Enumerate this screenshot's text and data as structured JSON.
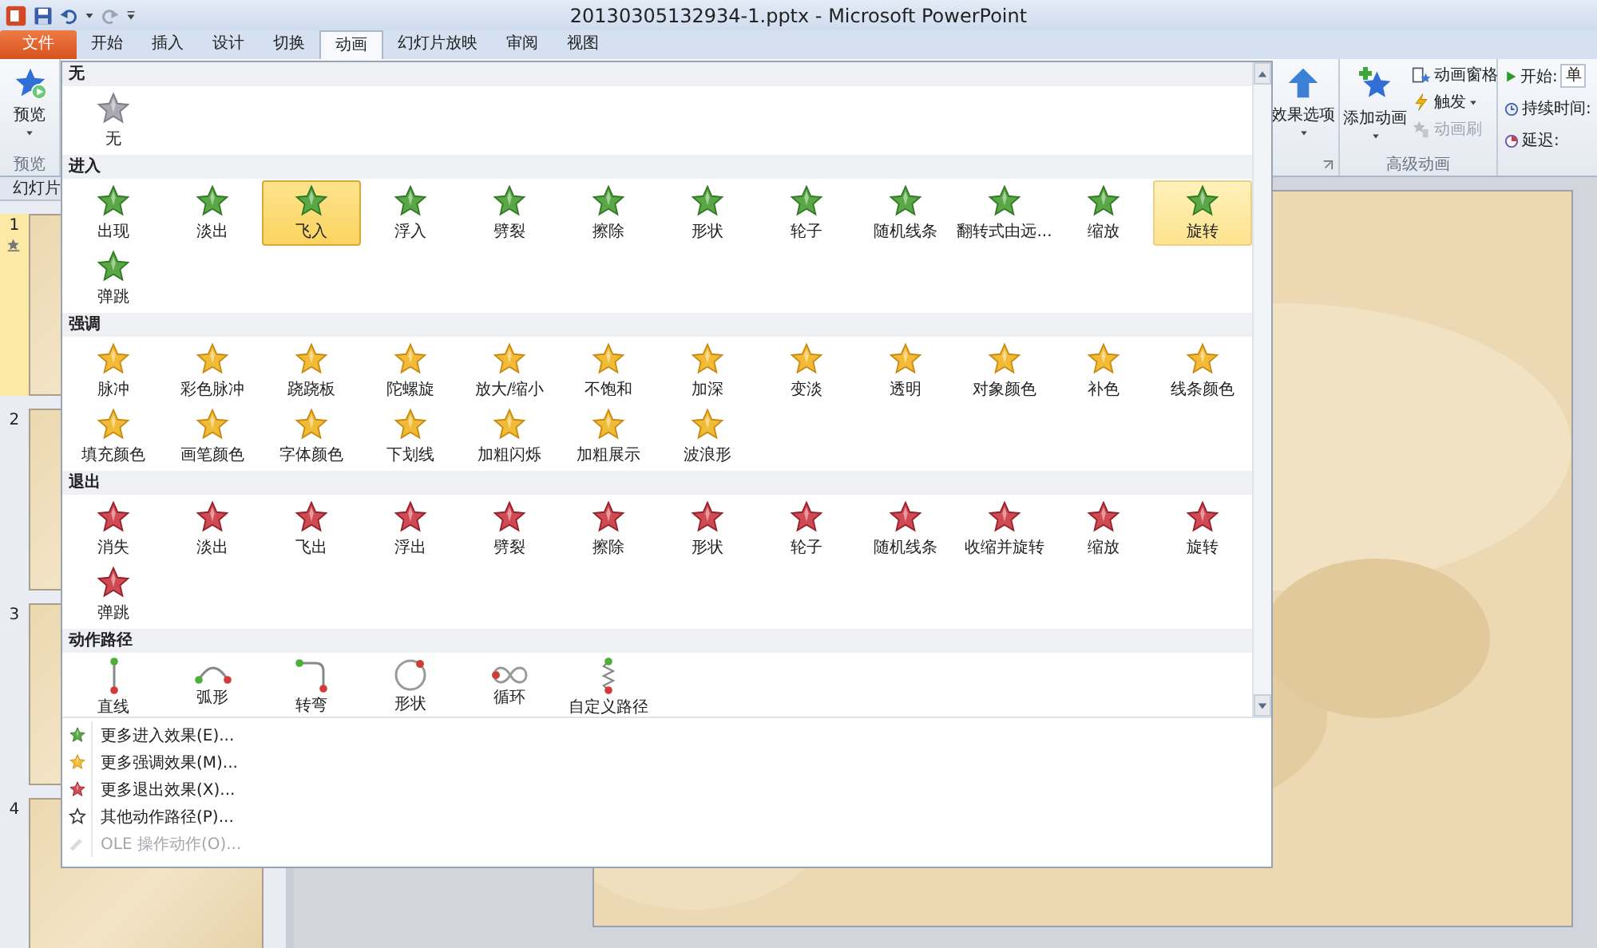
{
  "window": {
    "title": "20130305132934-1.pptx - Microsoft PowerPoint"
  },
  "tabs": [
    {
      "label": "文件",
      "kind": "file",
      "selected": false
    },
    {
      "label": "开始",
      "kind": "tab",
      "selected": false
    },
    {
      "label": "插入",
      "kind": "tab",
      "selected": false
    },
    {
      "label": "设计",
      "kind": "tab",
      "selected": false
    },
    {
      "label": "切换",
      "kind": "tab",
      "selected": false
    },
    {
      "label": "动画",
      "kind": "tab",
      "selected": true
    },
    {
      "label": "幻灯片放映",
      "kind": "tab",
      "selected": false
    },
    {
      "label": "审阅",
      "kind": "tab",
      "selected": false
    },
    {
      "label": "视图",
      "kind": "tab",
      "selected": false
    }
  ],
  "preview_group": {
    "button": "预览",
    "label": "预览"
  },
  "ribbon_right": {
    "effect_options": "效果选项",
    "add_animation": "添加动画",
    "animation_pane": "动画窗格",
    "trigger": "触发",
    "animation_painter": {
      "label": "动画刷",
      "disabled": true
    },
    "group_label": "高级动画",
    "start_label": "开始:",
    "start_value": "单",
    "duration_label": "持续时间:",
    "delay_label": "延迟:"
  },
  "slides_pane": {
    "title": "幻灯片",
    "slides": [
      {
        "number": "1",
        "selected": true
      },
      {
        "number": "2",
        "selected": false
      },
      {
        "number": "3",
        "selected": false
      },
      {
        "number": "4",
        "selected": false
      }
    ]
  },
  "gallery": {
    "sections": [
      {
        "title": "无",
        "kind": "none",
        "items": [
          {
            "label": "无",
            "selected": false,
            "hovered": false
          }
        ]
      },
      {
        "title": "进入",
        "kind": "entrance",
        "items": [
          {
            "label": "出现",
            "selected": false,
            "hovered": false
          },
          {
            "label": "淡出",
            "selected": false,
            "hovered": false
          },
          {
            "label": "飞入",
            "selected": true,
            "hovered": false
          },
          {
            "label": "浮入",
            "selected": false,
            "hovered": false
          },
          {
            "label": "劈裂",
            "selected": false,
            "hovered": false
          },
          {
            "label": "擦除",
            "selected": false,
            "hovered": false
          },
          {
            "label": "形状",
            "selected": false,
            "hovered": false
          },
          {
            "label": "轮子",
            "selected": false,
            "hovered": false
          },
          {
            "label": "随机线条",
            "selected": false,
            "hovered": false
          },
          {
            "label": "翻转式由远...",
            "selected": false,
            "hovered": false
          },
          {
            "label": "缩放",
            "selected": false,
            "hovered": false
          },
          {
            "label": "旋转",
            "selected": false,
            "hovered": true
          },
          {
            "label": "弹跳",
            "selected": false,
            "hovered": false
          }
        ]
      },
      {
        "title": "强调",
        "kind": "emphasis",
        "items": [
          {
            "label": "脉冲",
            "selected": false,
            "hovered": false
          },
          {
            "label": "彩色脉冲",
            "selected": false,
            "hovered": false
          },
          {
            "label": "跷跷板",
            "selected": false,
            "hovered": false
          },
          {
            "label": "陀螺旋",
            "selected": false,
            "hovered": false
          },
          {
            "label": "放大/缩小",
            "selected": false,
            "hovered": false
          },
          {
            "label": "不饱和",
            "selected": false,
            "hovered": false
          },
          {
            "label": "加深",
            "selected": false,
            "hovered": false
          },
          {
            "label": "变淡",
            "selected": false,
            "hovered": false
          },
          {
            "label": "透明",
            "selected": false,
            "hovered": false
          },
          {
            "label": "对象颜色",
            "selected": false,
            "hovered": false
          },
          {
            "label": "补色",
            "selected": false,
            "hovered": false
          },
          {
            "label": "线条颜色",
            "selected": false,
            "hovered": false
          },
          {
            "label": "填充颜色",
            "selected": false,
            "hovered": false
          },
          {
            "label": "画笔颜色",
            "selected": false,
            "hovered": false
          },
          {
            "label": "字体颜色",
            "selected": false,
            "hovered": false
          },
          {
            "label": "下划线",
            "selected": false,
            "hovered": false
          },
          {
            "label": "加粗闪烁",
            "selected": false,
            "hovered": false
          },
          {
            "label": "加粗展示",
            "selected": false,
            "hovered": false
          },
          {
            "label": "波浪形",
            "selected": false,
            "hovered": false
          }
        ]
      },
      {
        "title": "退出",
        "kind": "exit",
        "items": [
          {
            "label": "消失",
            "selected": false,
            "hovered": false
          },
          {
            "label": "淡出",
            "selected": false,
            "hovered": false
          },
          {
            "label": "飞出",
            "selected": false,
            "hovered": false
          },
          {
            "label": "浮出",
            "selected": false,
            "hovered": false
          },
          {
            "label": "劈裂",
            "selected": false,
            "hovered": false
          },
          {
            "label": "擦除",
            "selected": false,
            "hovered": false
          },
          {
            "label": "形状",
            "selected": false,
            "hovered": false
          },
          {
            "label": "轮子",
            "selected": false,
            "hovered": false
          },
          {
            "label": "随机线条",
            "selected": false,
            "hovered": false
          },
          {
            "label": "收缩并旋转",
            "selected": false,
            "hovered": false
          },
          {
            "label": "缩放",
            "selected": false,
            "hovered": false
          },
          {
            "label": "旋转",
            "selected": false,
            "hovered": false
          },
          {
            "label": "弹跳",
            "selected": false,
            "hovered": false
          }
        ]
      },
      {
        "title": "动作路径",
        "kind": "path",
        "items": [
          {
            "label": "直线",
            "kind": "line",
            "selected": false,
            "hovered": false
          },
          {
            "label": "弧形",
            "kind": "arc",
            "selected": false,
            "hovered": false
          },
          {
            "label": "转弯",
            "kind": "turn",
            "selected": false,
            "hovered": false
          },
          {
            "label": "形状",
            "kind": "circle",
            "selected": false,
            "hovered": false
          },
          {
            "label": "循环",
            "kind": "loop",
            "selected": false,
            "hovered": false
          },
          {
            "label": "自定义路径",
            "kind": "custom",
            "selected": false,
            "hovered": false
          }
        ]
      }
    ],
    "menu": [
      {
        "label": "更多进入效果(E)...",
        "kind": "entrance",
        "disabled": false
      },
      {
        "label": "更多强调效果(M)...",
        "kind": "emphasis",
        "disabled": false
      },
      {
        "label": "更多退出效果(X)...",
        "kind": "exit",
        "disabled": false
      },
      {
        "label": "其他动作路径(P)...",
        "kind": "path",
        "disabled": false
      },
      {
        "label": "OLE 操作动作(O)...",
        "kind": "ole",
        "disabled": true
      }
    ]
  }
}
